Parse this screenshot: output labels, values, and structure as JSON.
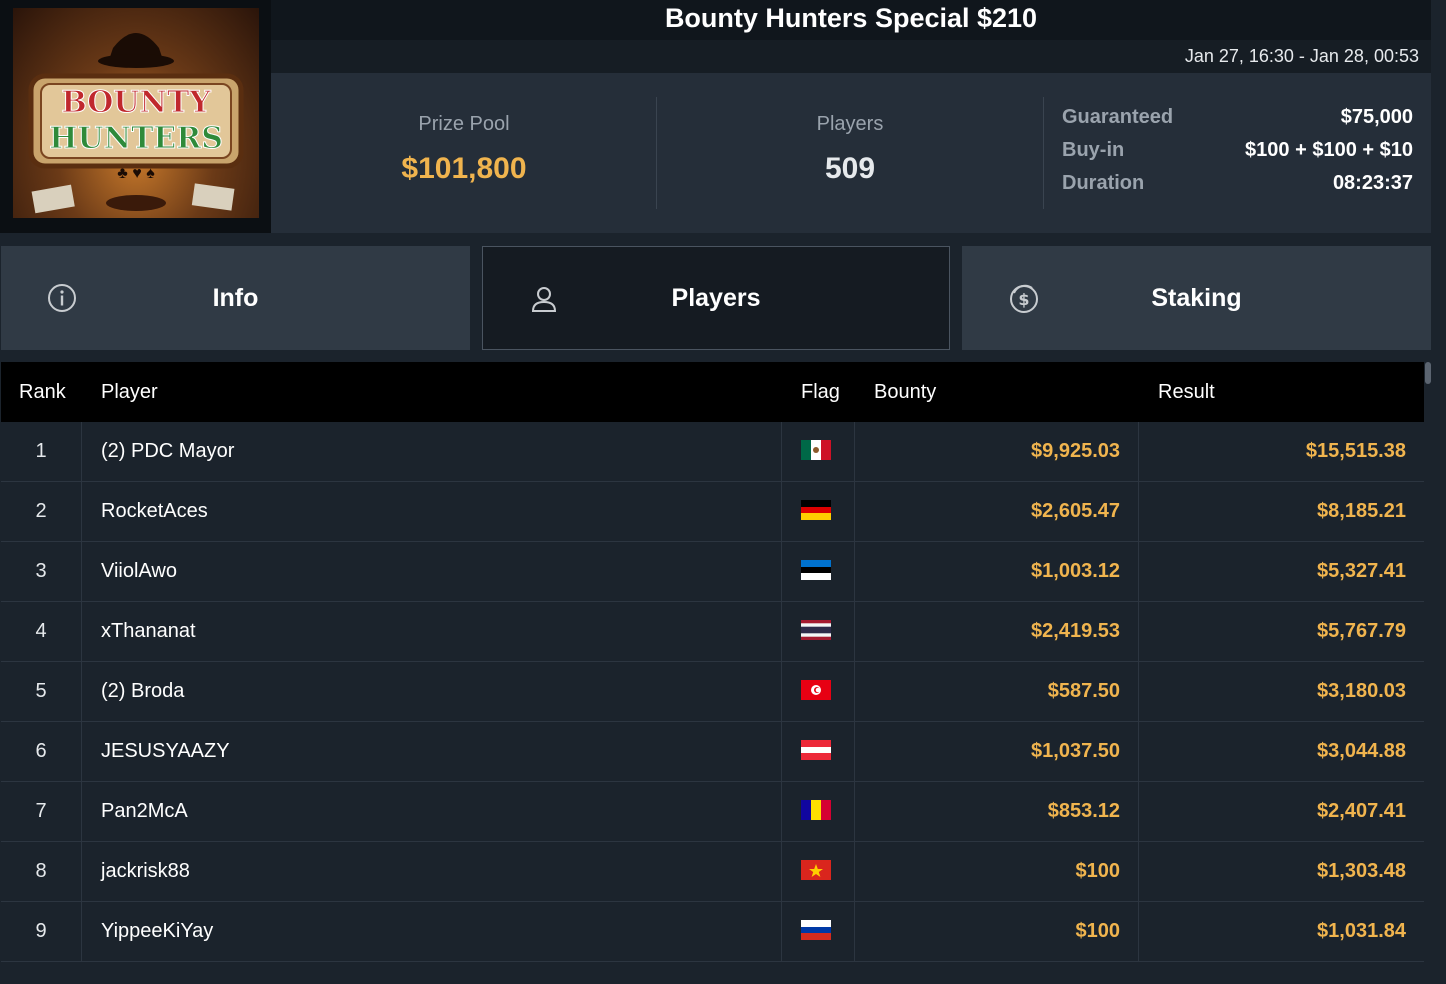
{
  "logo": {
    "line1": "BOUNTY",
    "line2": "HUNTERS"
  },
  "header": {
    "title": "Bounty Hunters Special $210",
    "dates": "Jan 27, 16:30 - Jan 28, 00:53"
  },
  "stats": {
    "prize_pool_label": "Prize Pool",
    "prize_pool_value": "$101,800",
    "players_label": "Players",
    "players_value": "509",
    "guaranteed_label": "Guaranteed",
    "guaranteed_value": "$75,000",
    "buyin_label": "Buy-in",
    "buyin_value": "$100 + $100 + $10",
    "duration_label": "Duration",
    "duration_value": "08:23:37"
  },
  "tabs": [
    {
      "label": "Info",
      "icon": "info-icon"
    },
    {
      "label": "Players",
      "icon": "user-icon",
      "active": true
    },
    {
      "label": "Staking",
      "icon": "dollar-coin-icon"
    }
  ],
  "table": {
    "headers": {
      "rank": "Rank",
      "player": "Player",
      "flag": "Flag",
      "bounty": "Bounty",
      "result": "Result"
    },
    "rows": [
      {
        "rank": "1",
        "player": "(2) PDC Mayor",
        "flag": "mexico",
        "bounty": "$9,925.03",
        "result": "$15,515.38"
      },
      {
        "rank": "2",
        "player": "RocketAces",
        "flag": "germany",
        "bounty": "$2,605.47",
        "result": "$8,185.21"
      },
      {
        "rank": "3",
        "player": "ViiolAwo",
        "flag": "estonia",
        "bounty": "$1,003.12",
        "result": "$5,327.41"
      },
      {
        "rank": "4",
        "player": "xThananat",
        "flag": "thailand",
        "bounty": "$2,419.53",
        "result": "$5,767.79"
      },
      {
        "rank": "5",
        "player": "(2) Broda",
        "flag": "tunisia",
        "bounty": "$587.50",
        "result": "$3,180.03"
      },
      {
        "rank": "6",
        "player": "JESUSYAAZY",
        "flag": "austria",
        "bounty": "$1,037.50",
        "result": "$3,044.88"
      },
      {
        "rank": "7",
        "player": "Pan2McA",
        "flag": "andorra",
        "bounty": "$853.12",
        "result": "$2,407.41"
      },
      {
        "rank": "8",
        "player": "jackrisk88",
        "flag": "vietnam",
        "bounty": "$100",
        "result": "$1,303.48"
      },
      {
        "rank": "9",
        "player": "YippeeKiYay",
        "flag": "russia",
        "bounty": "$100",
        "result": "$1,031.84"
      }
    ]
  },
  "colors": {
    "accent_gold": "#f0b44e",
    "background": "#1b232c"
  }
}
